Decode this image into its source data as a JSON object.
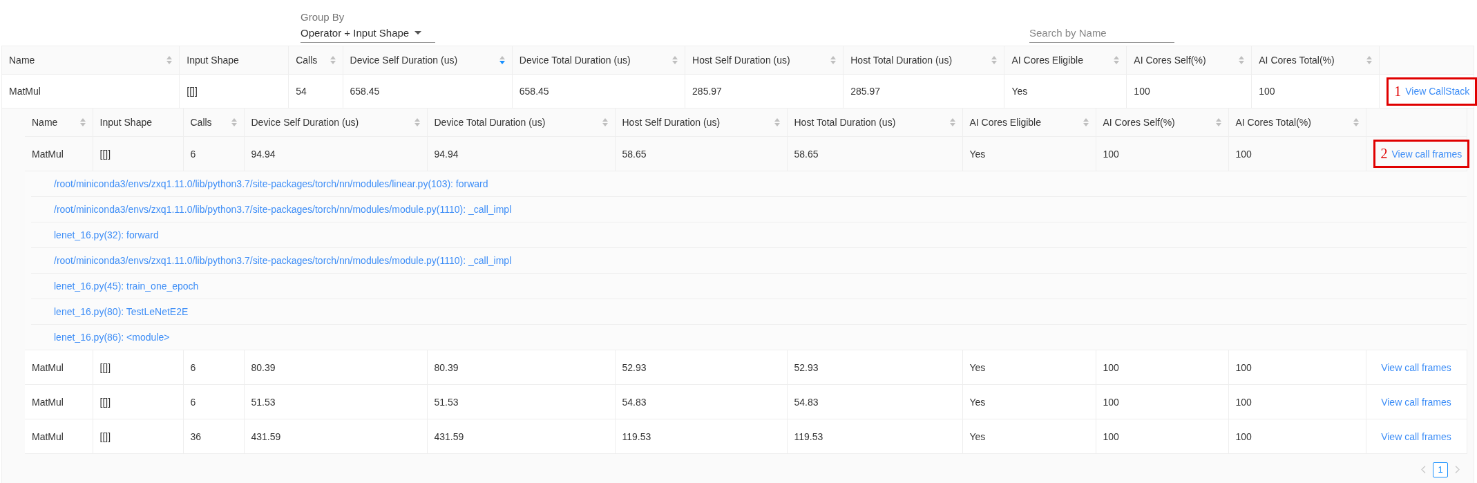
{
  "group_by": {
    "label": "Group By",
    "value": "Operator + Input Shape"
  },
  "search": {
    "placeholder": "Search by Name"
  },
  "table": {
    "columns": [
      {
        "label": "Name",
        "sortable": true,
        "sorted_descending": false
      },
      {
        "label": "Input Shape",
        "sortable": false
      },
      {
        "label": "Calls",
        "sortable": true,
        "sorted_descending": false
      },
      {
        "label": "Device Self Duration (us)",
        "sortable": true,
        "sorted_descending": true
      },
      {
        "label": "Device Total Duration (us)",
        "sortable": true,
        "sorted_descending": false
      },
      {
        "label": "Host Self Duration (us)",
        "sortable": true,
        "sorted_descending": false
      },
      {
        "label": "Host Total Duration (us)",
        "sortable": true,
        "sorted_descending": false
      },
      {
        "label": "AI Cores Eligible",
        "sortable": true,
        "sorted_descending": false
      },
      {
        "label": "AI Cores Self(%)",
        "sortable": true,
        "sorted_descending": false
      },
      {
        "label": "AI Cores Total(%)",
        "sortable": true,
        "sorted_descending": false
      }
    ],
    "rows": [
      {
        "cells": [
          "MatMul",
          "[[]]",
          "54",
          "658.45",
          "658.45",
          "285.97",
          "285.97",
          "Yes",
          "100",
          "100"
        ],
        "action": "View CallStack",
        "annotation": "1",
        "expanded": true,
        "sub_table": {
          "columns": [
            {
              "label": "Name",
              "sortable": true,
              "sorted_descending": false
            },
            {
              "label": "Input Shape",
              "sortable": false
            },
            {
              "label": "Calls",
              "sortable": true,
              "sorted_descending": false
            },
            {
              "label": "Device Self Duration (us)",
              "sortable": true,
              "sorted_descending": false
            },
            {
              "label": "Device Total Duration (us)",
              "sortable": true,
              "sorted_descending": false
            },
            {
              "label": "Host Self Duration (us)",
              "sortable": true,
              "sorted_descending": false
            },
            {
              "label": "Host Total Duration (us)",
              "sortable": true,
              "sorted_descending": false
            },
            {
              "label": "AI Cores Eligible",
              "sortable": true,
              "sorted_descending": false
            },
            {
              "label": "AI Cores Self(%)",
              "sortable": true,
              "sorted_descending": false
            },
            {
              "label": "AI Cores Total(%)",
              "sortable": true,
              "sorted_descending": false
            }
          ],
          "rows": [
            {
              "cells": [
                "MatMul",
                "[[]]",
                "6",
                "94.94",
                "94.94",
                "58.65",
                "58.65",
                "Yes",
                "100",
                "100"
              ],
              "action": "View call frames",
              "annotation": "2",
              "expanded": true,
              "call_frames": [
                "/root/miniconda3/envs/zxq1.11.0/lib/python3.7/site-packages/torch/nn/modules/linear.py(103): forward",
                "/root/miniconda3/envs/zxq1.11.0/lib/python3.7/site-packages/torch/nn/modules/module.py(1110): _call_impl",
                "lenet_16.py(32): forward",
                "/root/miniconda3/envs/zxq1.11.0/lib/python3.7/site-packages/torch/nn/modules/module.py(1110): _call_impl",
                "lenet_16.py(45): train_one_epoch",
                "lenet_16.py(80): TestLeNetE2E",
                "lenet_16.py(86): <module>"
              ]
            },
            {
              "cells": [
                "MatMul",
                "[[]]",
                "6",
                "80.39",
                "80.39",
                "52.93",
                "52.93",
                "Yes",
                "100",
                "100"
              ],
              "action": "View call frames",
              "expanded": false
            },
            {
              "cells": [
                "MatMul",
                "[[]]",
                "6",
                "51.53",
                "51.53",
                "54.83",
                "54.83",
                "Yes",
                "100",
                "100"
              ],
              "action": "View call frames",
              "expanded": false
            },
            {
              "cells": [
                "MatMul",
                "[[]]",
                "36",
                "431.59",
                "431.59",
                "119.53",
                "119.53",
                "Yes",
                "100",
                "100"
              ],
              "action": "View call frames",
              "expanded": false
            }
          ]
        }
      }
    ]
  },
  "pagination": {
    "pages": [
      {
        "label": "1",
        "selected": true
      }
    ]
  }
}
